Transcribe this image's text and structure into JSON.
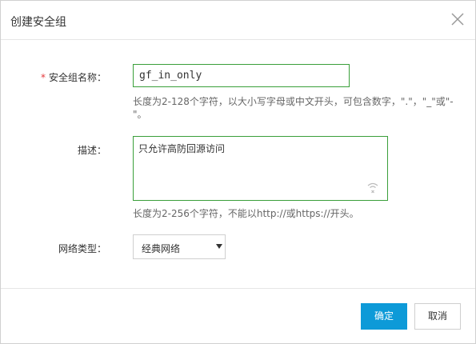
{
  "dialog": {
    "title": "创建安全组",
    "close_icon": "close-icon"
  },
  "form": {
    "name": {
      "required_mark": "*",
      "label": "安全组名称：",
      "value": "gf_in_only",
      "hint_line1": "长度为2-128个字符，以大小写字母或中文开头，可包含数字，\".\"，\"_\"或\"-",
      "hint_line2": "\"。"
    },
    "description": {
      "label": "描述：",
      "value": "只允许高防回源访问",
      "hint": "长度为2-256个字符，不能以http://或https://开头。",
      "resize_icon": "wifi-off-icon"
    },
    "network_type": {
      "label": "网络类型：",
      "selected": "经典网络",
      "caret_icon": "caret-down-icon"
    }
  },
  "footer": {
    "confirm_label": "确定",
    "cancel_label": "取消"
  },
  "colors": {
    "primary": "#0d9ad8",
    "valid_border": "#3a9f3a",
    "required": "#e4393c"
  }
}
